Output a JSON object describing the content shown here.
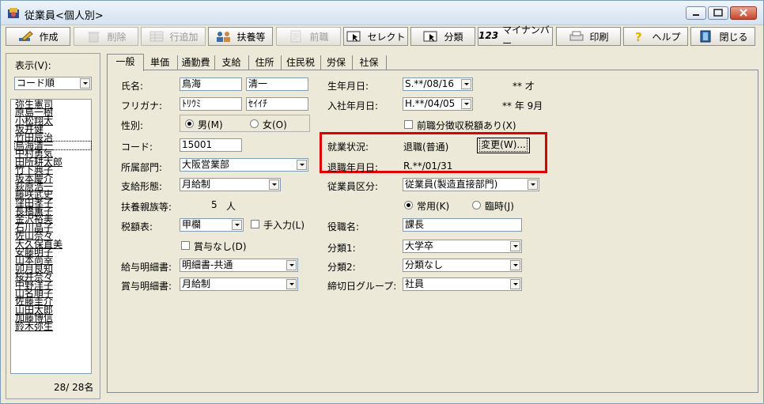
{
  "window": {
    "title": "従業員<個人別>"
  },
  "toolbar": [
    {
      "key": "create",
      "label": "作成",
      "icon": "pencil-icon",
      "enabled": true
    },
    {
      "key": "delete",
      "label": "削除",
      "icon": "trash-icon",
      "enabled": false
    },
    {
      "key": "add_row",
      "label": "行追加",
      "icon": "table-icon",
      "enabled": false
    },
    {
      "key": "dependents",
      "label": "扶養等",
      "icon": "family-icon",
      "enabled": true
    },
    {
      "key": "prev_job",
      "label": "前職",
      "icon": "document-icon",
      "enabled": false
    },
    {
      "key": "select",
      "label": "セレクト",
      "icon": "select-cursor-icon",
      "enabled": true
    },
    {
      "key": "classify",
      "label": "分類",
      "icon": "classify-cursor-icon",
      "enabled": true
    },
    {
      "key": "mynumber",
      "label": "マイナンバー",
      "icon": "mynumber-icon",
      "icon_text": "123",
      "enabled": true
    },
    {
      "key": "print",
      "label": "印刷",
      "icon": "printer-icon",
      "enabled": true
    },
    {
      "key": "help",
      "label": "ヘルプ",
      "icon": "help-icon",
      "enabled": true
    },
    {
      "key": "close",
      "label": "閉じる",
      "icon": "exit-door-icon",
      "enabled": true
    }
  ],
  "left": {
    "display_label": "表示(V):",
    "sort_value": "コード順",
    "employees": [
      "弥生憲司",
      "原島一樹",
      "小松翔太",
      "坂井健",
      "竹田辰治",
      "鳥海清一",
      "中村勇気",
      "田所耕太郎",
      "竹下典子",
      "坂本慶介",
      "萩原浩一",
      "藤咲武史",
      "窪田孝子",
      "長橋薫子",
      "金沢裕美",
      "石川晶子",
      "佐山奈々",
      "大久保直美",
      "安藤明子",
      "山本尚幸",
      "卯月良知",
      "桜井奈々",
      "中野洋子",
      "山名順子",
      "佐藤圭介",
      "山田太郎",
      "加藤博信",
      "鈴木弥生"
    ],
    "selected_index": 5,
    "count": "28/ 28名"
  },
  "tabs": [
    "一般",
    "単価",
    "通勤費",
    "支給",
    "住所",
    "住民税",
    "労保",
    "社保"
  ],
  "active_tab": 0,
  "form": {
    "name_label": "氏名:",
    "last_name": "鳥海",
    "first_name": "清一",
    "kana_label": "フリガナ:",
    "last_kana": "ﾄﾘｳﾐ",
    "first_kana": "ｾｲｲﾁ",
    "gender_label": "性別:",
    "gender_male": "男(M)",
    "gender_female": "女(O)",
    "code_label": "コード:",
    "code": "15001",
    "dept_label": "所属部門:",
    "dept": "大阪営業部",
    "pay_type_label": "支給形態:",
    "pay_type": "月給制",
    "dependents_label": "扶養親族等:",
    "dependents_value": "5",
    "dependents_unit": "人",
    "tax_table_label": "税額表:",
    "tax_table": "甲欄",
    "manual_input": "手入力(L)",
    "no_bonus": "賞与なし(D)",
    "payslip_label": "給与明細書:",
    "payslip": "明細書-共通",
    "bonus_slip_label": "賞与明細書:",
    "bonus_slip": "月給制",
    "birth_label": "生年月日:",
    "birth": "S.**/08/16",
    "age": "** 才",
    "hire_label": "入社年月日:",
    "hire": "H.**/04/05",
    "tenure": "** 年  9月",
    "prev_job_tax": "前職分徴収税額あり(X)",
    "employment_label": "就業状況:",
    "employment": "退職(普通)",
    "change_button": "変更(W)...",
    "retire_label": "退職年月日:",
    "retire_date": "R.**/01/31",
    "emp_class_label": "従業員区分:",
    "emp_class": "従業員(製造直接部門)",
    "regular": "常用(K)",
    "temporary": "臨時(J)",
    "position_label": "役職名:",
    "position": "課長",
    "class1_label": "分類1:",
    "class1": "大学卒",
    "class2_label": "分類2:",
    "class2": "分類なし",
    "cutoff_label": "締切日グループ:",
    "cutoff": "社員"
  }
}
